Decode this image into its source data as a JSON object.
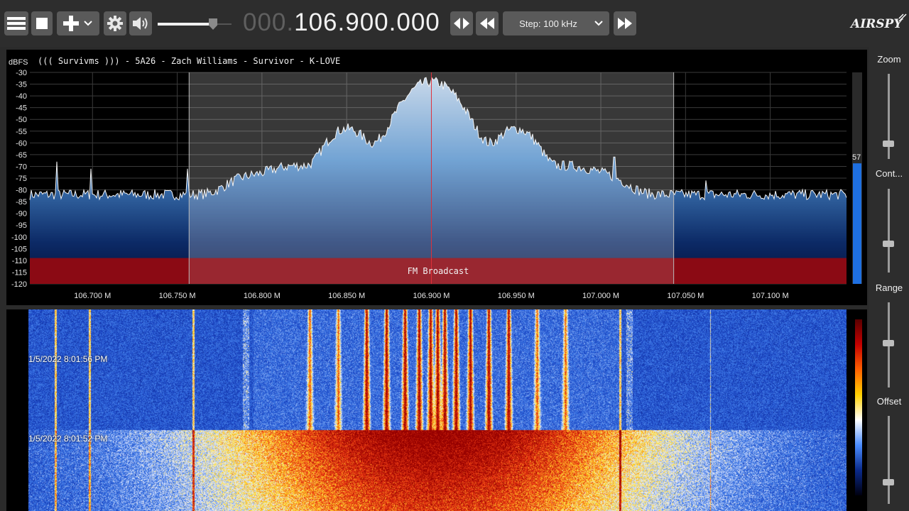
{
  "toolbar": {
    "menu_icon": "hamburger-menu-icon",
    "stop_icon": "stop-square-icon",
    "add_icon": "plus-icon",
    "settings_icon": "gear-icon",
    "volume_icon": "speaker-icon",
    "volume_level": 0.75,
    "frequency_dim": "000.",
    "frequency_bright": "106.900.000",
    "tune_icon": "left-right-arrows-icon",
    "rewind_icon": "rewind-icon",
    "step_label": "Step: 100 kHz",
    "forward_icon": "fast-forward-icon",
    "logo": "AIRSPY"
  },
  "spectrum": {
    "unit_label": "dBFS",
    "rds_text": "((( Survivms ))) - 5A26 - Zach Williams - Survivor - K-LOVE",
    "y_ticks": [
      "-30",
      "-35",
      "-40",
      "-45",
      "-50",
      "-55",
      "-60",
      "-65",
      "-70",
      "-75",
      "-80",
      "-85",
      "-90",
      "-95",
      "-100",
      "-105",
      "-110",
      "-115",
      "-120"
    ],
    "x_ticks": [
      "106.700 M",
      "106.750 M",
      "106.800 M",
      "106.850 M",
      "106.900 M",
      "106.950 M",
      "107.000 M",
      "107.050 M",
      "107.100 M"
    ],
    "band_label": "FM Broadcast",
    "level_value": "57",
    "center_frequency_mhz": 106.9,
    "filter_low_mhz": 106.757,
    "filter_high_mhz": 107.043
  },
  "waterfall": {
    "timestamps": [
      "1/5/2022 8:01:56 PM",
      "1/5/2022 8:01:52 PM"
    ]
  },
  "sidebar": {
    "zoom_label": "Zoom",
    "contrast_label": "Cont...",
    "range_label": "Range",
    "offset_label": "Offset"
  },
  "colors": {
    "background": "#2b2b2b",
    "band_red": "#8b0a14",
    "spectrum_fill": "#3a78b8",
    "waterfall_blue": "#1a3aa8"
  }
}
